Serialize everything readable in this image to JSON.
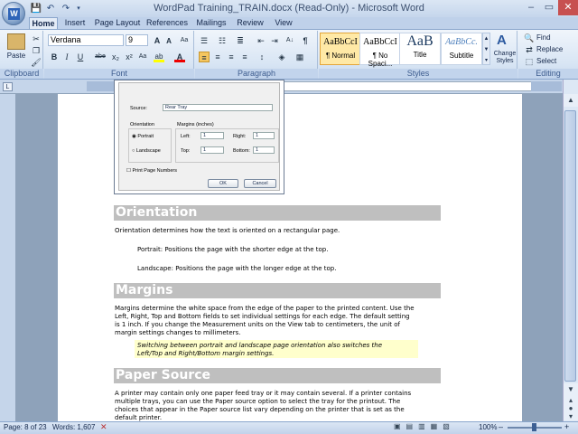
{
  "window": {
    "title": "WordPad Training_TRAIN.docx (Read-Only) - Microsoft Word",
    "logo_letter": "W"
  },
  "window_buttons": [
    "–",
    "▭",
    "✕"
  ],
  "qat": {
    "save": "💾",
    "undo": "↶",
    "redo": "↷"
  },
  "tabs": [
    "Home",
    "Insert",
    "Page Layout",
    "References",
    "Mailings",
    "Review",
    "View"
  ],
  "ribbon": {
    "clipboard": {
      "paste": "Paste",
      "label": "Clipboard"
    },
    "font": {
      "name": "Verdana",
      "size": "9",
      "label": "Font",
      "grow": "A",
      "shrink": "A",
      "clear": "Aa",
      "bold": "B",
      "italic": "I",
      "underline": "U",
      "strike": "abe",
      "sub": "x₂",
      "sup": "x²",
      "changecase": "Aa",
      "highlight": "ab",
      "color": "A"
    },
    "paragraph": {
      "label": "Paragraph",
      "sort": "A↓",
      "pilcrow": "¶"
    },
    "styles": {
      "label": "Styles",
      "items": [
        {
          "preview": "AaBbCcI",
          "name": "¶ Normal"
        },
        {
          "preview": "AaBbCcI",
          "name": "¶ No Spaci..."
        },
        {
          "preview": "AaB",
          "name": "Title"
        },
        {
          "preview": "AaBbCc.",
          "name": "Subtitle"
        }
      ],
      "change": "Change Styles"
    },
    "editing": {
      "find": "Find",
      "replace": "Replace",
      "select": "Select",
      "label": "Editing"
    }
  },
  "dialog": {
    "source_label": "Source:",
    "source_value": "Rear Tray",
    "orientation_label": "Orientation",
    "portrait": "Portrait",
    "landscape": "Landscape",
    "margins_label": "Margins (inches)",
    "left": "Left:",
    "left_val": "1",
    "right": "Right:",
    "right_val": "1",
    "top": "Top:",
    "top_val": "1",
    "bottom": "Bottom:",
    "bottom_val": "1",
    "print_page_numbers": "Print Page Numbers",
    "ok": "OK",
    "cancel": "Cancel"
  },
  "document": {
    "h1": "Orientation",
    "p1": "Orientation determines how the text is oriented on a rectangular page.",
    "p2": "Portrait: Positions the page with the shorter edge at the top.",
    "p3": "Landscape: Positions the page with the longer edge at the top.",
    "h2": "Margins",
    "p4_l1": "Margins determine the white space from the edge of the paper to the printed content. Use the",
    "p4_l2": "Left, Right, Top and Bottom fields to set individual settings for each edge. The default setting",
    "p4_l3": "is 1 inch. If you change the Measurement units on the View tab to centimeters, the unit of",
    "p4_l4": "margin settings changes to millimeters.",
    "note_l1": "Switching between portrait and landscape page orientation also switches the",
    "note_l2": "Left/Top and Right/Bottom margin settings.",
    "h3": "Paper Source",
    "p5_l1": "A printer may contain only one paper feed tray or it may contain several. If a printer contains",
    "p5_l2": "multiple trays, you can use the Paper source option to select the tray for the printout. The",
    "p5_l3": "choices that appear in the Paper source list vary depending on the printer that is set as the",
    "p5_l4": "default printer."
  },
  "status": {
    "page": "Page: 8 of 23",
    "words": "Words: 1,607",
    "zoom": "100%",
    "zoom_minus": "–",
    "zoom_plus": "+"
  }
}
